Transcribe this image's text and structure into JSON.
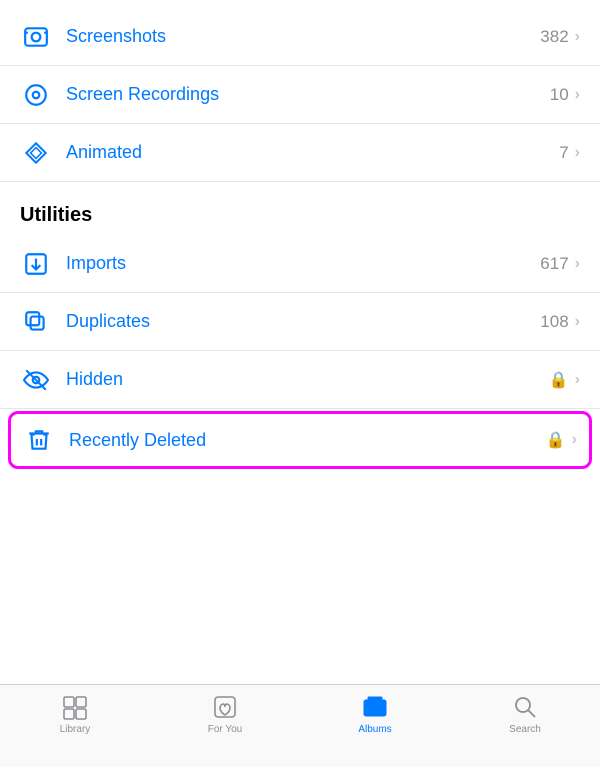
{
  "items_top": [
    {
      "id": "screenshots",
      "label": "Screenshots",
      "count": "382",
      "icon": "camera",
      "hasLock": false
    },
    {
      "id": "screen-recordings",
      "label": "Screen Recordings",
      "count": "10",
      "icon": "screen-record",
      "hasLock": false
    },
    {
      "id": "animated",
      "label": "Animated",
      "count": "7",
      "icon": "animated",
      "hasLock": false
    }
  ],
  "utilities_header": "Utilities",
  "items_utilities": [
    {
      "id": "imports",
      "label": "Imports",
      "count": "617",
      "icon": "imports",
      "hasLock": false
    },
    {
      "id": "duplicates",
      "label": "Duplicates",
      "count": "108",
      "icon": "duplicates",
      "hasLock": false
    },
    {
      "id": "hidden",
      "label": "Hidden",
      "count": "",
      "icon": "hidden",
      "hasLock": true
    },
    {
      "id": "recently-deleted",
      "label": "Recently Deleted",
      "count": "",
      "icon": "trash",
      "hasLock": true
    }
  ],
  "tabs": [
    {
      "id": "library",
      "label": "Library",
      "active": false
    },
    {
      "id": "for-you",
      "label": "For You",
      "active": false
    },
    {
      "id": "albums",
      "label": "Albums",
      "active": true
    },
    {
      "id": "search",
      "label": "Search",
      "active": false
    }
  ]
}
